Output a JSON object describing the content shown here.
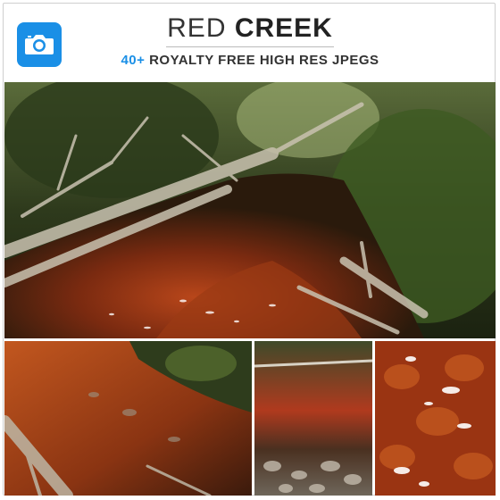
{
  "header": {
    "title_light": "RED",
    "title_bold": "CREEK",
    "subtitle_accent": "40+",
    "subtitle_rest": "ROYALTY FREE HIGH RES JPEGS",
    "icon": "camera-icon",
    "accent_color": "#1a8fe6"
  },
  "photos": [
    {
      "name": "main-photo"
    },
    {
      "name": "creek-thumbnail-1"
    },
    {
      "name": "creek-thumbnail-2"
    },
    {
      "name": "creek-thumbnail-3"
    }
  ]
}
